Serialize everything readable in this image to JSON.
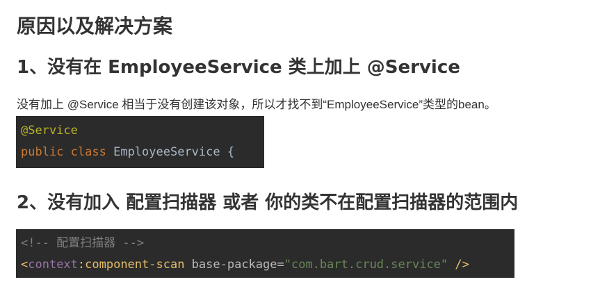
{
  "title": "原因以及解决方案",
  "section1": {
    "heading": "1、没有在 EmployeeService 类上加上 @Service",
    "paragraph": "没有加上 @Service 相当于没有创建该对象，所以才找不到“EmployeeService”类型的bean。",
    "code": {
      "annotation": "@Service",
      "kw_public": "public",
      "kw_class": "class",
      "classname": " EmployeeService {"
    }
  },
  "section2": {
    "heading": "2、没有加入 配置扫描器 或者 你的类不在配置扫描器的范围内",
    "code": {
      "comment": "<!-- 配置扫描器 -->",
      "open_bracket": "<",
      "ns": "context",
      "colon_tag": ":component-scan",
      "attr": " base-package",
      "equals": "=",
      "value": "\"com.bart.crud.service\"",
      "close": " />"
    }
  }
}
